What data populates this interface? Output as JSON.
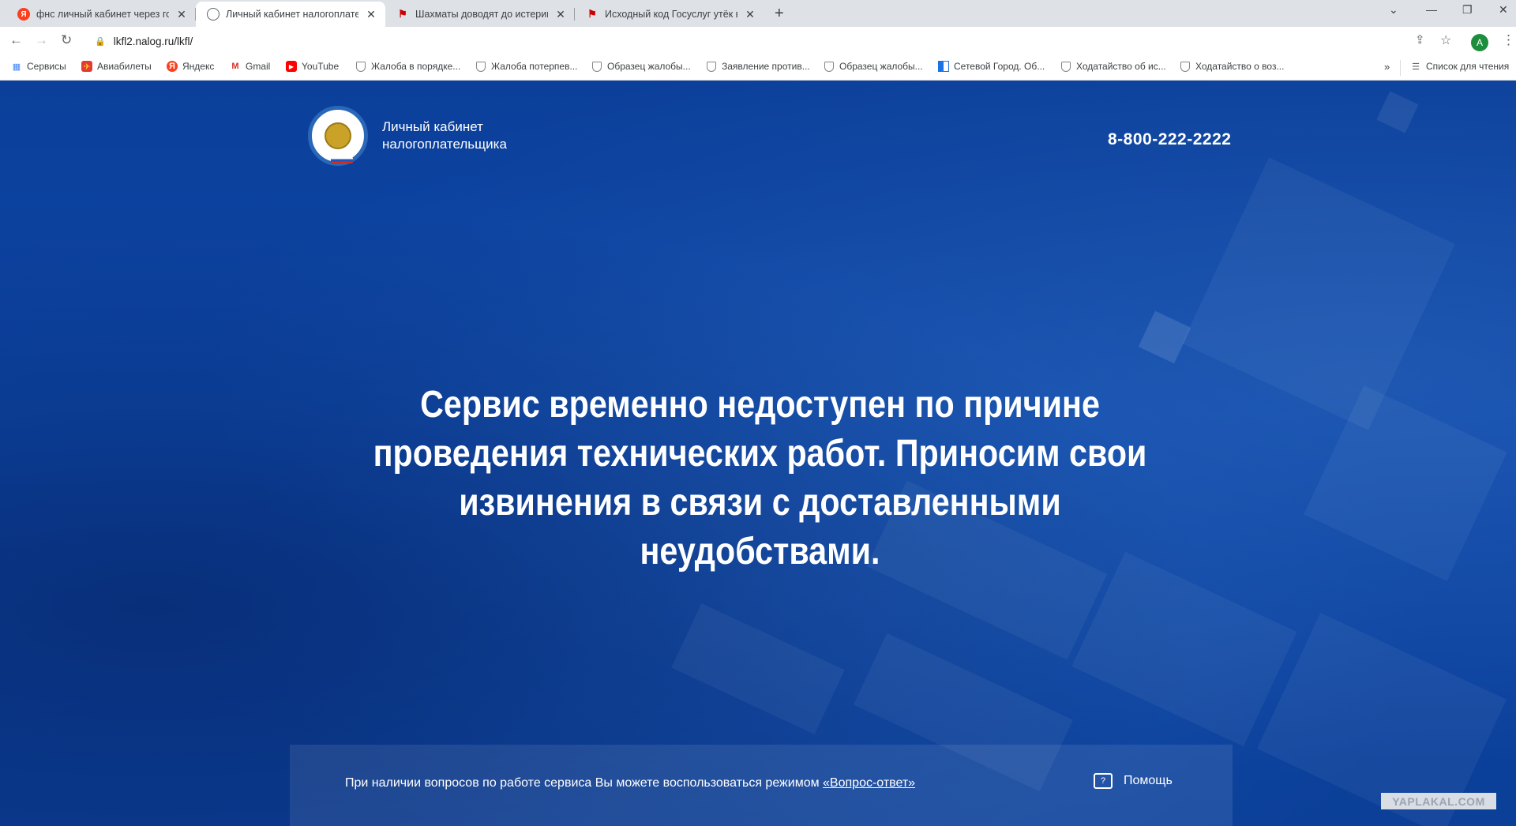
{
  "tabs": [
    {
      "title": "фнс личный кабинет через госуслуги",
      "icon": "yandex-icon",
      "active": false
    },
    {
      "title": "Личный кабинет налогоплательщика",
      "icon": "globe-icon",
      "active": true
    },
    {
      "title": "Шахматы доводят до истерики",
      "icon": "yaplakal-icon",
      "active": false
    },
    {
      "title": "Исходный код Госуслуг утёк в сеть",
      "icon": "yaplakal-icon",
      "active": false
    }
  ],
  "address_bar": {
    "url": "lkfl2.nalog.ru/lkfl/"
  },
  "profile_initial": "A",
  "bookmarks": [
    {
      "label": "Сервисы",
      "icon": "apps-grid-icon"
    },
    {
      "label": "Авиабилеты",
      "icon": "tickets-icon"
    },
    {
      "label": "Яндекс",
      "icon": "yandex-icon"
    },
    {
      "label": "Gmail",
      "icon": "gmail-icon"
    },
    {
      "label": "YouTube",
      "icon": "youtube-icon"
    },
    {
      "label": "Жалоба в порядке...",
      "icon": "shield-icon"
    },
    {
      "label": "Жалоба потерпев...",
      "icon": "shield-icon"
    },
    {
      "label": "Образец жалобы...",
      "icon": "shield-icon"
    },
    {
      "label": "Заявление против...",
      "icon": "shield-icon"
    },
    {
      "label": "Образец жалобы...",
      "icon": "shield-icon"
    },
    {
      "label": "Сетевой Город. Об...",
      "icon": "school-icon"
    },
    {
      "label": "Ходатайство об ис...",
      "icon": "shield-icon"
    },
    {
      "label": "Ходатайство о воз...",
      "icon": "shield-icon"
    }
  ],
  "reading_list": "Список для чтения",
  "header": {
    "logo_line1": "Личный кабинет",
    "logo_line2": "налогоплательщика",
    "phone": "8-800-222-2222"
  },
  "main_message": "Сервис временно недоступен по причине проведения технических работ. Приносим свои извинения в связи с доставленными неудобствами.",
  "footer": {
    "text": "При наличии вопросов по работе сервиса Вы можете воспользоваться режимом ",
    "link": "«Вопрос-ответ»",
    "help_label": "Помощь"
  },
  "watermark": "YAPLAKAL.COM"
}
